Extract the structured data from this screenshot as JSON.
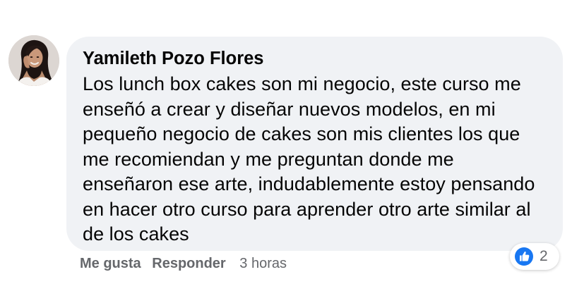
{
  "comment": {
    "author": "Yamileth Pozo Flores",
    "text": "Los lunch box cakes son mi negocio, este curso me enseñó a crear y diseñar nuevos modelos, en mi pequeño negocio de cakes son mis clientes los que me recomiendan y me preguntan donde me enseñaron ese arte, indudablemente estoy pensando en hacer otro curso para aprender otro arte similar al de los cakes",
    "actions": {
      "like_label": "Me gusta",
      "reply_label": "Responder",
      "timestamp": "3 horas"
    },
    "reactions": {
      "icon": "like-icon",
      "count": "2",
      "color": "#1877f2"
    }
  },
  "colors": {
    "bubble_bg": "#f0f2f5",
    "text": "#050505",
    "secondary_text": "#65676b",
    "like_blue": "#1877f2"
  }
}
